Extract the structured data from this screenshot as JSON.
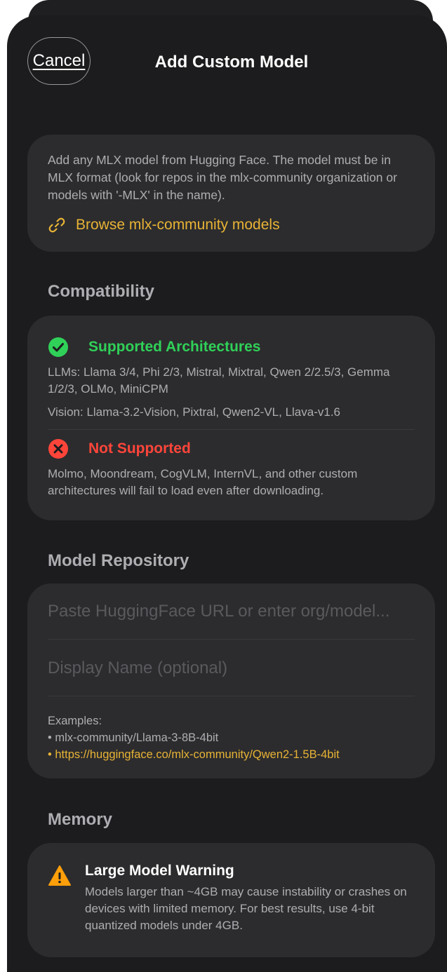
{
  "header": {
    "cancel_label": "Cancel",
    "title": "Add Custom Model"
  },
  "intro": {
    "description": "Add any MLX model from Hugging Face. The model must be in MLX format (look for repos in the mlx-community organization or models with '-MLX' in the name).",
    "browse_link": "Browse mlx-community models"
  },
  "compatibility": {
    "heading": "Compatibility",
    "supported_title": "Supported Architectures",
    "llms": "LLMs: Llama 3/4, Phi 2/3, Mistral, Mixtral, Qwen 2/2.5/3, Gemma 1/2/3, OLMo, MiniCPM",
    "vision": "Vision: Llama-3.2-Vision, Pixtral, Qwen2-VL, Llava-v1.6",
    "unsupported_title": "Not Supported",
    "unsupported_text": "Molmo, Moondream, CogVLM, InternVL, and other custom architectures will fail to load even after downloading."
  },
  "repository": {
    "heading": "Model Repository",
    "url_placeholder": "Paste HuggingFace URL or enter org/model...",
    "name_placeholder": "Display Name (optional)",
    "examples_label": "Examples:",
    "example_1": "• mlx-community/Llama-3-8B-4bit",
    "example_2": "• https://huggingface.co/mlx-community/Qwen2-1.5B-4bit"
  },
  "memory": {
    "heading": "Memory",
    "warning_title": "Large Model Warning",
    "warning_text": "Models larger than ~4GB may cause instability or crashes on devices with limited memory. For best results, use 4-bit quantized models under 4GB."
  },
  "colors": {
    "accent_yellow": "#e8b335",
    "success_green": "#30d158",
    "error_red": "#ff453a",
    "warning_orange": "#ff9f0a"
  }
}
